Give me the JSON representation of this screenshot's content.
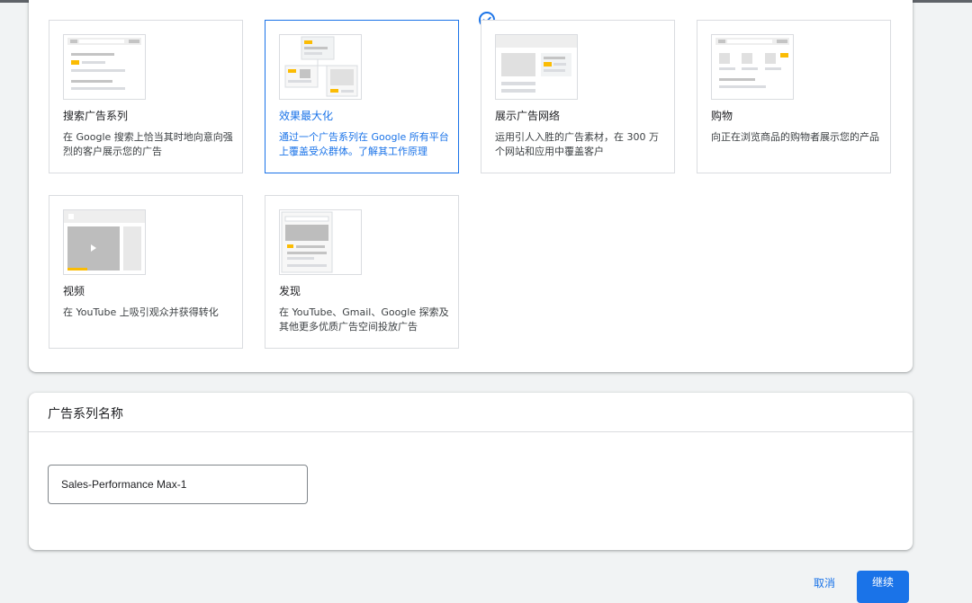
{
  "campaign_types": [
    {
      "title": "搜索广告系列",
      "description": "在 Google 搜索上恰当其时地向意向强烈的客户展示您的广告"
    },
    {
      "title": "效果最大化",
      "description": "通过一个广告系列在 Google 所有平台上覆盖受众群体。了解其工作原理"
    },
    {
      "title": "展示广告网络",
      "description": "运用引人入胜的广告素材，在 300 万个网站和应用中覆盖客户"
    },
    {
      "title": "购物",
      "description": "向正在浏览商品的购物者展示您的产品"
    },
    {
      "title": "视频",
      "description": "在 YouTube 上吸引观众并获得转化"
    },
    {
      "title": "发现",
      "description": "在 YouTube、Gmail、Google 探索及其他更多优质广告空间投放广告"
    }
  ],
  "campaign_name": {
    "heading": "广告系列名称",
    "value": "Sales-Performance Max-1"
  },
  "footer": {
    "cancel_label": "取消",
    "continue_label": "继续"
  },
  "colors": {
    "accent": "#1a73e8",
    "thumb_yellow": "#fbbc04",
    "thumb_gray": "#dadce0"
  }
}
